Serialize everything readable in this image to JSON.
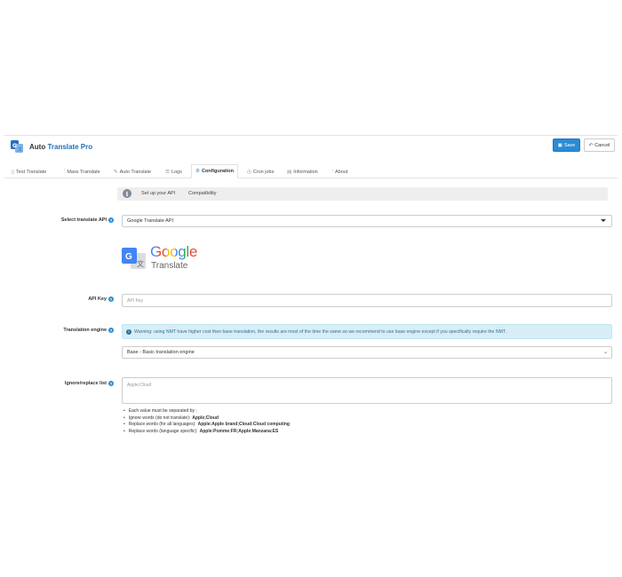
{
  "header": {
    "app_name_plain": "Auto ",
    "app_name_accent": "Translate Pro",
    "save_label": "Save",
    "cancel_label": "Cancel"
  },
  "tabs": [
    {
      "label": "Test Translate",
      "icon": "file-icon"
    },
    {
      "label": "Mass Translate",
      "icon": "sliders-icon"
    },
    {
      "label": "Auto Translate",
      "icon": "pencil-icon"
    },
    {
      "label": "Logs",
      "icon": "list-icon"
    },
    {
      "label": "Configuration",
      "icon": "gear-icon",
      "active": true
    },
    {
      "label": "Cron jobs",
      "icon": "clock-icon"
    },
    {
      "label": "Information",
      "icon": "document-icon"
    },
    {
      "label": "About",
      "icon": "info-icon"
    }
  ],
  "subtabs": [
    "Set up your API",
    "Compatibility"
  ],
  "form": {
    "api_label": "Select translate API",
    "api_value": "Google Translate API",
    "google_logo_word": "Google",
    "google_logo_sub": "Translate",
    "key_label": "API Key",
    "key_placeholder": "API Key",
    "engine_label": "Translation engine",
    "engine_warning": "Warning: using NMT have higher cost then base translation, the results are most of the time the same so we recommend to use base engine except if you specifically require the NMT.",
    "engine_value": "Base - Basic translation engine",
    "ignore_label": "Ignore/replace list",
    "ignore_placeholder": "Apple;Cloud"
  },
  "notes": [
    {
      "text": "Each value must be separated by ;",
      "bold": ""
    },
    {
      "text": "Ignore words (do not translate): ",
      "bold": "Apple;Cloud"
    },
    {
      "text": "Replace words (for all languages): ",
      "bold": "Apple:Apple brand;Cloud:Cloud computing"
    },
    {
      "text": "Replace words (language specific): ",
      "bold": "Apple:Pomme:FR;Apple:Manzana:ES"
    }
  ],
  "colors": {
    "primary": "#2a8bd6",
    "alert_bg": "#d9edf7",
    "alert_text": "#31708f",
    "google_blue": "#4285F4",
    "google_red": "#EA4335",
    "google_yellow": "#FBBC05",
    "google_green": "#34A853"
  }
}
